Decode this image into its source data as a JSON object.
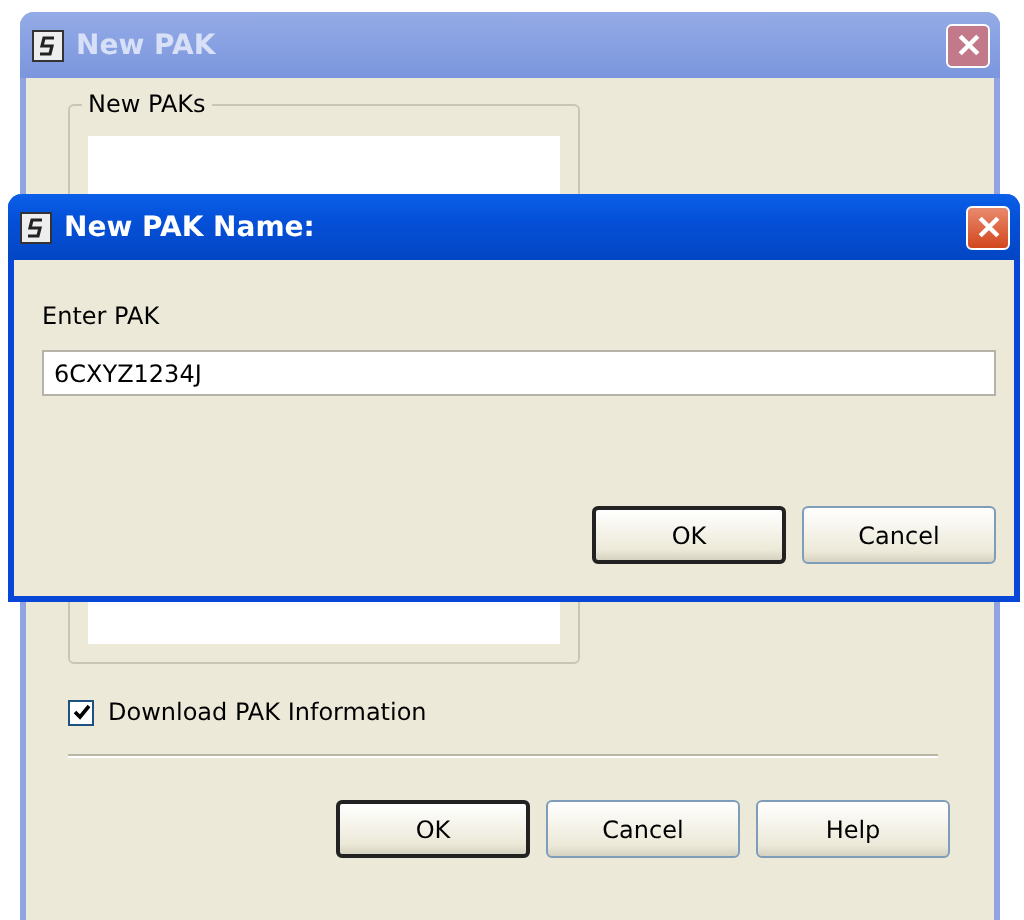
{
  "main_window": {
    "title": "New PAK",
    "active": false,
    "group": {
      "label": "New PAKs"
    },
    "checkbox": {
      "label": "Download PAK Information",
      "checked": true
    },
    "buttons": [
      {
        "label": "OK",
        "default": true
      },
      {
        "label": "Cancel",
        "default": false
      },
      {
        "label": "Help",
        "default": false
      }
    ]
  },
  "dialog": {
    "title": "New PAK Name:",
    "active": true,
    "prompt": "Enter PAK",
    "value": "6CXYZ1234J",
    "buttons": [
      {
        "label": "OK",
        "default": true
      },
      {
        "label": "Cancel",
        "default": false
      }
    ]
  }
}
